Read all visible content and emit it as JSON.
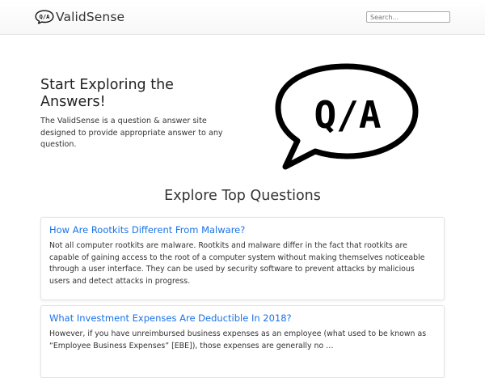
{
  "header": {
    "brand_name": "ValidSense",
    "logo_text": "Q/A",
    "search_placeholder": "Search..."
  },
  "hero": {
    "title": "Start Exploring the Answers!",
    "description": "The ValidSense is a question & answer site designed to provide appropriate answer to any question.",
    "graphic_text": "Q/A"
  },
  "questions_section": {
    "title": "Explore Top Questions",
    "items": [
      {
        "title": "How Are Rootkits Different From Malware?",
        "excerpt": "Not all computer rootkits are malware. Rootkits and malware differ in the fact that rootkits are capable of gaining access to the root of a computer system without making themselves noticeable through a user interface. They can be used by security software to prevent attacks by malicious users and detect attacks in progress."
      },
      {
        "title": "What Investment Expenses Are Deductible In 2018?",
        "excerpt": "However, if you have unreimbursed business expenses as an employee (what used to be known as “Employee Business Expenses” [EBE]), those expenses are generally no …"
      }
    ]
  },
  "colors": {
    "link": "#1a73e8",
    "text": "#212529",
    "icon": "#111111"
  }
}
